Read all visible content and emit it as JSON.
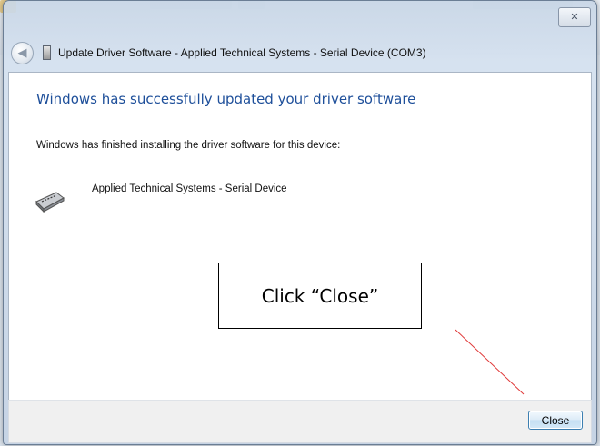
{
  "dialog": {
    "title": "Update Driver Software - Applied Technical Systems - Serial Device (COM3)",
    "close_glyph": "✕"
  },
  "content": {
    "heading": "Windows has successfully updated your driver software",
    "subtext": "Windows has finished installing the driver software for this device:",
    "device_name": "Applied Technical Systems - Serial Device"
  },
  "footer": {
    "close_label": "Close"
  },
  "annotation": {
    "callout_text": "Click “Close”",
    "arrow_color": "#e03a3a"
  },
  "colors": {
    "heading": "#1e4f9a",
    "button_border": "#3c7fb1"
  },
  "icons": {
    "back": "back-arrow-icon",
    "device": "serial-device-icon"
  }
}
